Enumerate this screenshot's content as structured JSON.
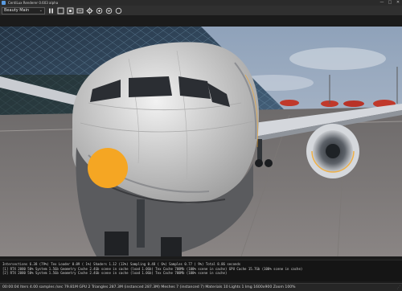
{
  "window": {
    "title": "CentiLux Renderer 0.603 alpha",
    "controls": [
      "—",
      "□",
      "✕"
    ]
  },
  "toolbar": {
    "render_mode": "Beauty Main",
    "caret": "⌄",
    "buttons": [
      "pause-icon",
      "frame-icon",
      "crop-icon",
      "resolution-icon",
      "settings-icon",
      "zoom-fit-icon",
      "rotate-left-icon",
      "rotate-right-icon"
    ]
  },
  "stats": {
    "lines": [
      "Intersections   6.38 (79%) Tex Loader    0.09 ( 1%) Shaders    1.12 (13%) Sampling   0.48 ( 6%) Samples   0.77 ( 9%) Total    8.86 seconds",
      "[1] RTX 2080  50%  System   1.5Gb  Geometry Cache  2.4Gb scene in cache (load   1.0Gb)  Tex Cache  708Mb (100% scene in cache)  GPU Cache  15.7Gb (100% scene in cache)",
      "[2] RTX 2080  50%  System   1.5Gb  Geometry Cache  2.4Gb scene in cache (load   1.0Gb)  Tex Cache  708Mb (100% scene in cache)"
    ]
  },
  "status": {
    "text": "00:00:04   Iters 4.00  samples /sec 79.81M     GPU 2  Triangles 287.3M (instanced 287.3M)  Meshes 7 (instanced 7)  Materials 10  Lights 1  Img 1600x900  Zoom 100%"
  },
  "colors": {
    "accent_orange": "#F5A623",
    "umbrella_red": "#C0392B",
    "sky": "#9FB0C4"
  }
}
